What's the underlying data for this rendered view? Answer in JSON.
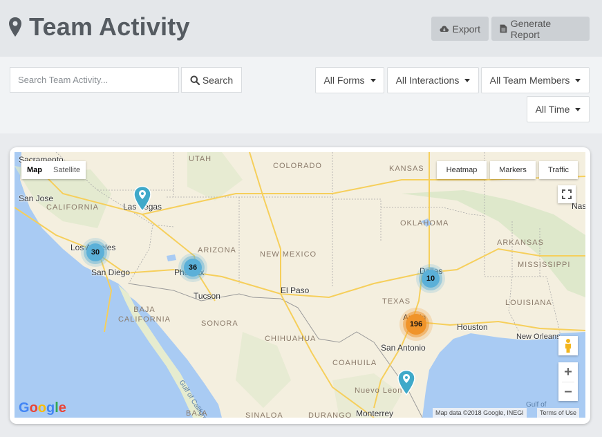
{
  "header": {
    "title": "Team Activity",
    "export_label": "Export",
    "report_label": "Generate Report"
  },
  "filters": {
    "search_placeholder": "Search Team Activity...",
    "search_button": "Search",
    "forms": "All Forms",
    "interactions": "All Interactions",
    "members": "All Team Members",
    "time": "All Time"
  },
  "map": {
    "type_options": [
      "Map",
      "Satellite"
    ],
    "active_type": "Map",
    "layers": [
      "Heatmap",
      "Markers",
      "Traffic"
    ],
    "zoom_in": "+",
    "zoom_out": "−",
    "google_letters": [
      "G",
      "o",
      "o",
      "g",
      "l",
      "e"
    ],
    "google_colors": [
      "#4285F4",
      "#EA4335",
      "#FBBC05",
      "#4285F4",
      "#34A853",
      "#EA4335"
    ],
    "map_data": "Map data ©2018 Google, INEGI",
    "terms": "Terms of Use",
    "cities": [
      "Sacramento",
      "San Jose",
      "Las Vegas",
      "Los Angeles",
      "San Diego",
      "Phoenix",
      "Tucson",
      "El Paso",
      "Dallas",
      "Austin",
      "San Antonio",
      "Houston",
      "New Orleans",
      "Monterrey",
      "Nuevo Leon",
      "Nas"
    ],
    "regions": [
      "UTAH",
      "COLORADO",
      "KANSAS",
      "CALIFORNIA",
      "OKLAHOMA",
      "ARIZONA",
      "NEW MEXICO",
      "ARKANSAS",
      "MISSISSIPPI",
      "TEXAS",
      "LOUISIANA",
      "BAJA CALIFORNIA",
      "SONORA",
      "CHIHUAHUA",
      "COAHUILA",
      "SINALOA",
      "DURANGO",
      "BAJA"
    ],
    "water_labels": [
      "Gulf of California",
      "Gulf of"
    ],
    "clusters": [
      {
        "count": "30",
        "color": "blue",
        "near": "Los Angeles"
      },
      {
        "count": "36",
        "color": "blue",
        "near": "Phoenix"
      },
      {
        "count": "10",
        "color": "blue",
        "near": "Dallas"
      },
      {
        "count": "196",
        "color": "orange",
        "near": "Austin"
      }
    ],
    "pins": [
      "Las Vegas",
      "Nuevo Leon"
    ]
  },
  "colors": {
    "accent_blue": "#5bb0d8",
    "accent_orange": "#f0942a",
    "pin_color": "#3fa9c9",
    "button_gray": "#ccd0d4"
  }
}
